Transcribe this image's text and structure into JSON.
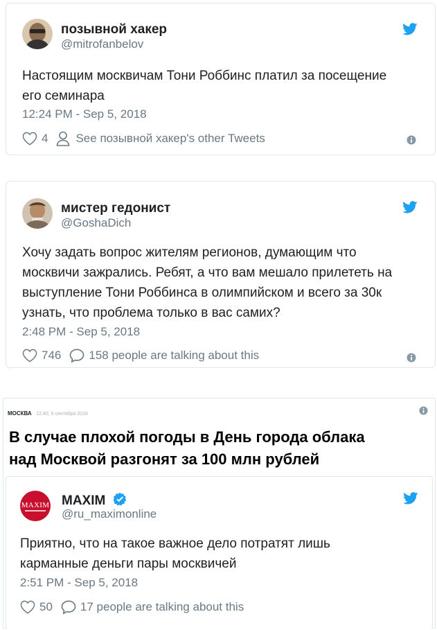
{
  "tweet1": {
    "name": "позывной хакер",
    "handle": "@mitrofanbelov",
    "text_lines": [
      "Настоящим москвичам Тони Роббинс платил за посещение",
      "его семинара"
    ],
    "time": "12:24 PM - Sep 5, 2018",
    "likes": "4",
    "secondary": "See позывной хакер's other Tweets"
  },
  "tweet2": {
    "name": "мистер гедонист",
    "handle": "@GoshaDich",
    "text_lines": [
      "Хочу задать вопрос жителям регионов, думающим что",
      "москвичи зажрались. Ребят, а что вам мешало прилететь на",
      "выступление Тони Роббинса в олимпийском и всего за 30к",
      "узнать, что проблема только в вас самих?"
    ],
    "time": "2:48 PM - Sep 5, 2018",
    "likes": "746",
    "secondary": "158 people are talking about this"
  },
  "article": {
    "category": "МОСКВА",
    "date": "12:40, 5 сентября 2018",
    "headline_lines": [
      "В случае плохой погоды в День города облака",
      "над Москвой разгонят за 100 млн рублей"
    ]
  },
  "tweet3": {
    "name": "MAXIM",
    "handle": "@ru_maximonline",
    "avatar_text": "MAXIM",
    "text_lines": [
      "Приятно, что на такое важное дело потратят лишь",
      "карманные деньги пары москвичей"
    ],
    "time": "2:51 PM - Sep 5, 2018",
    "likes": "50",
    "secondary": "17 people are talking about this"
  },
  "colors": {
    "twitter_blue": "#1da1f2",
    "maxim_red": "#c8102e",
    "muted": "#697882"
  },
  "icons": [
    "twitter-bird-icon",
    "heart-icon",
    "person-icon",
    "speech-bubble-icon",
    "info-icon",
    "verified-badge-icon"
  ]
}
